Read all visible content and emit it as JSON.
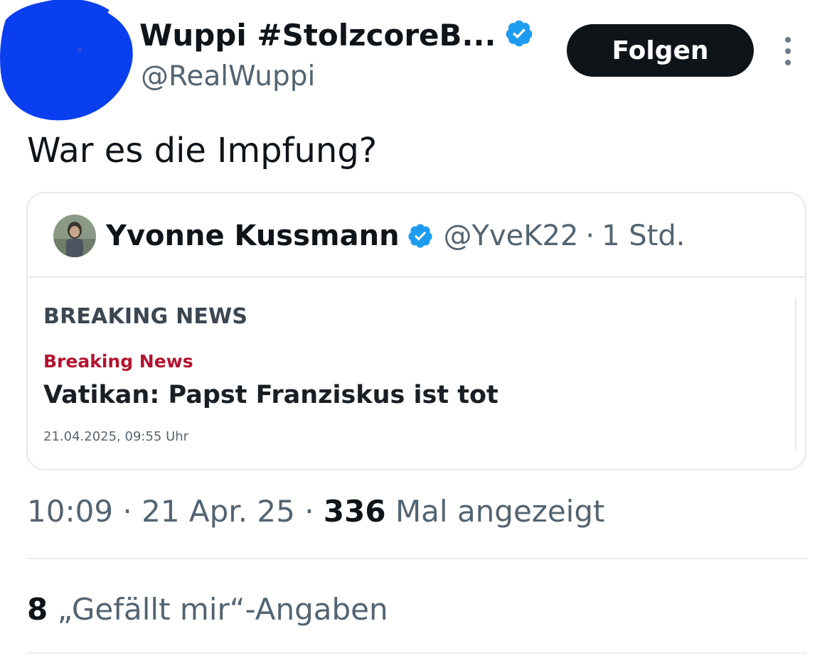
{
  "author": {
    "display_name": "Wuppi #StolzcoreB...",
    "handle": "@RealWuppi",
    "verified_icon": "verified-badge-icon",
    "avatar_redaction_color": "#0a3ff0"
  },
  "actions": {
    "follow_label": "Folgen",
    "more_icon": "more-vertical-icon"
  },
  "tweet": {
    "text": "War es die Impfung?"
  },
  "quote": {
    "display_name": "Yvonne Kussmann",
    "handle": "@YveK22",
    "separator": "·",
    "time_ago": "1 Std.",
    "card": {
      "section_label": "BREAKING NEWS",
      "kicker": "Breaking News",
      "headline": "Vatikan: Papst Franziskus ist tot",
      "date": "21.04.2025, 09:55 Uhr"
    }
  },
  "meta": {
    "time": "10:09",
    "sep1": " · ",
    "date": "21 Apr. 25",
    "sep2": " · ",
    "views_count": "336",
    "views_label": " Mal angezeigt"
  },
  "likes": {
    "count": "8",
    "label": " „Gefällt mir“-Angaben"
  },
  "colors": {
    "text_primary": "#0f1419",
    "text_secondary": "#536471",
    "verified_blue": "#1d9bf0",
    "kicker_red": "#b3132f"
  }
}
